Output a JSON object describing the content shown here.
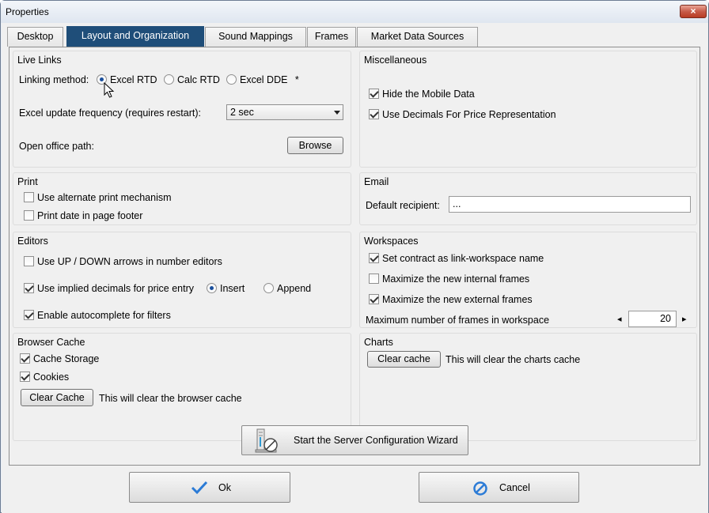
{
  "window": {
    "title": "Properties",
    "close_glyph": "×"
  },
  "tabs": [
    {
      "label": "Desktop",
      "active": false
    },
    {
      "label": "Layout and Organization",
      "active": true
    },
    {
      "label": "Sound Mappings",
      "active": false
    },
    {
      "label": "Frames",
      "active": false
    },
    {
      "label": "Market Data Sources",
      "active": false
    }
  ],
  "live_links": {
    "label": "Live Links",
    "linking_method_label": "Linking method:",
    "options": [
      "Excel RTD",
      "Calc RTD",
      "Excel DDE"
    ],
    "selected": "Excel RTD",
    "asterisk": "*",
    "frequency_label": "Excel update frequency (requires restart):",
    "frequency_value": "2 sec",
    "office_path_label": "Open office path:",
    "browse_label": "Browse"
  },
  "misc": {
    "label": "Miscellaneous",
    "hide_mobile": {
      "label": "Hide the Mobile Data",
      "checked": true
    },
    "use_decimals": {
      "label": "Use Decimals For Price Representation",
      "checked": true
    }
  },
  "print": {
    "label": "Print",
    "alt_print": {
      "label": "Use alternate print mechanism",
      "checked": false
    },
    "print_date": {
      "label": "Print date in page footer",
      "checked": false
    }
  },
  "email": {
    "label": "Email",
    "recipient_label": "Default recipient:",
    "recipient_value": "..."
  },
  "editors": {
    "label": "Editors",
    "updown": {
      "label": "Use UP / DOWN arrows in number editors",
      "checked": false
    },
    "implied": {
      "label": "Use implied decimals for price entry",
      "checked": true
    },
    "insert_label": "Insert",
    "append_label": "Append",
    "insert_selected": true,
    "autocomplete": {
      "label": "Enable autocomplete for filters",
      "checked": true
    }
  },
  "workspaces": {
    "label": "Workspaces",
    "set_contract": {
      "label": "Set contract as link-workspace name",
      "checked": true
    },
    "max_internal": {
      "label": "Maximize the new internal frames",
      "checked": false
    },
    "max_external": {
      "label": "Maximize the new external frames",
      "checked": true
    },
    "max_frames_label": "Maximum number of frames in workspace",
    "max_frames_value": "20",
    "left_arrow": "◂",
    "right_arrow": "▸"
  },
  "browser_cache": {
    "label": "Browser Cache",
    "cache_storage": {
      "label": "Cache Storage",
      "checked": true
    },
    "cookies": {
      "label": "Cookies",
      "checked": true
    },
    "clear_label": "Clear Cache",
    "clear_note": "This will clear the browser cache"
  },
  "charts": {
    "label": "Charts",
    "clear_label": "Clear cache",
    "clear_note": "This will clear the charts cache"
  },
  "wizard_label": "Start the Server Configuration Wizard",
  "ok_label": "Ok",
  "cancel_label": "Cancel",
  "colors": {
    "active_tab": "#1f4e79",
    "ok_icon": "#2b7bd6",
    "cancel_icon": "#2b7bd6"
  }
}
